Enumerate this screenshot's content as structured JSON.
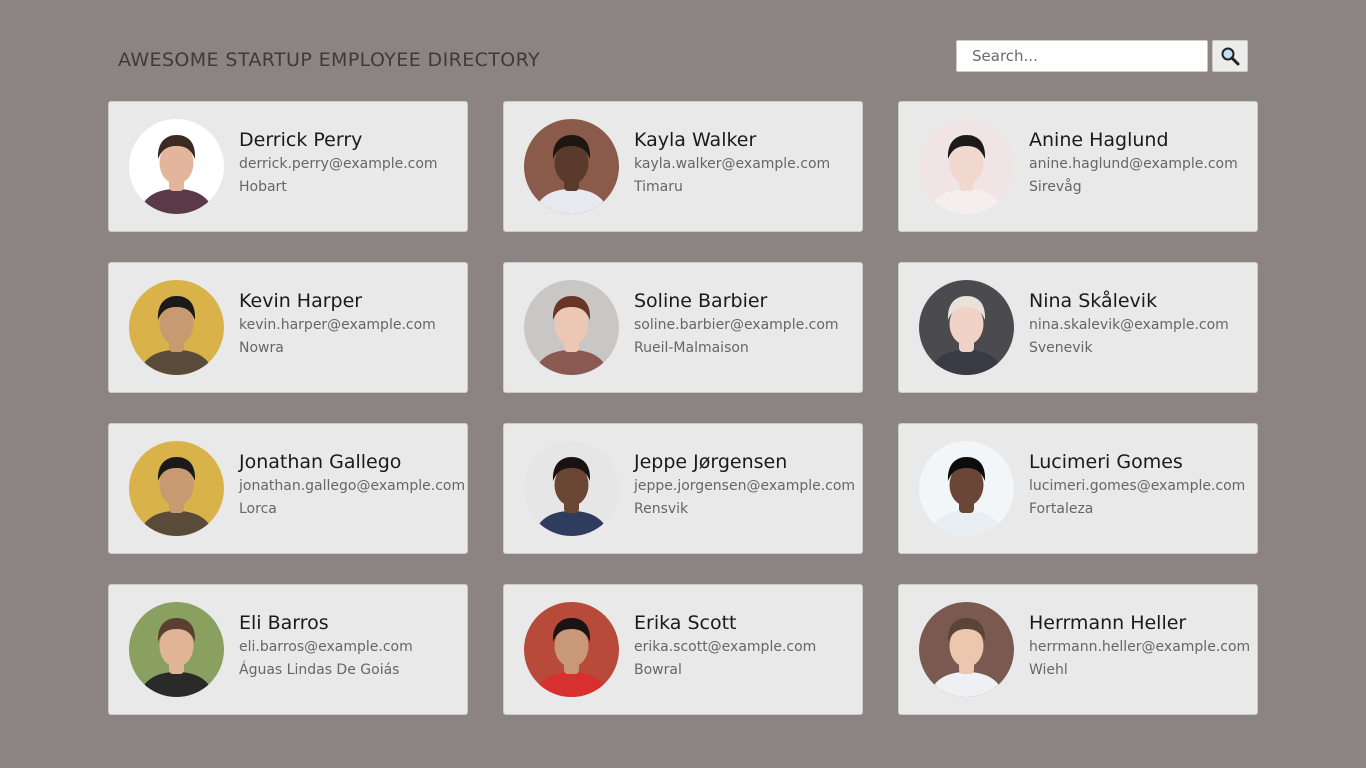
{
  "header": {
    "title": "AWESOME STARTUP EMPLOYEE DIRECTORY",
    "search_placeholder": "Search...",
    "search_icon": "magnifier-icon"
  },
  "employees": [
    {
      "name": "Derrick Perry",
      "email": "derrick.perry@example.com",
      "city": "Hobart",
      "avatar": {
        "bg": "#ffffff",
        "skin": "#e3b59c",
        "hair": "#3a2a22",
        "shirt": "#5b3a48"
      }
    },
    {
      "name": "Kayla Walker",
      "email": "kayla.walker@example.com",
      "city": "Timaru",
      "avatar": {
        "bg": "#8a5a4a",
        "skin": "#5a3a2c",
        "hair": "#1f1612",
        "shirt": "#e8e8f0"
      }
    },
    {
      "name": "Anine Haglund",
      "email": "anine.haglund@example.com",
      "city": "Sirevåg",
      "avatar": {
        "bg": "#f1e4e4",
        "skin": "#f0d8cf",
        "hair": "#1b1b1b",
        "shirt": "#f5eeee"
      }
    },
    {
      "name": "Kevin Harper",
      "email": "kevin.harper@example.com",
      "city": "Nowra",
      "avatar": {
        "bg": "#d9b24a",
        "skin": "#c89a72",
        "hair": "#1a1a1a",
        "shirt": "#5a4a3a"
      }
    },
    {
      "name": "Soline Barbier",
      "email": "soline.barbier@example.com",
      "city": "Rueil-Malmaison",
      "avatar": {
        "bg": "#c9c6c6",
        "skin": "#ecc8b4",
        "hair": "#6a3526",
        "shirt": "#8a5a52"
      }
    },
    {
      "name": "Nina Skålevik",
      "email": "nina.skalevik@example.com",
      "city": "Svenevik",
      "avatar": {
        "bg": "#4b4a4e",
        "skin": "#f0d2c6",
        "hair": "#e8e2d8",
        "shirt": "#3a3a44"
      }
    },
    {
      "name": "Jonathan Gallego",
      "email": "jonathan.gallego@example.com",
      "city": "Lorca",
      "avatar": {
        "bg": "#d9b24a",
        "skin": "#c89a72",
        "hair": "#1a1a1a",
        "shirt": "#5a4a3a"
      }
    },
    {
      "name": "Jeppe Jørgensen",
      "email": "jeppe.jorgensen@example.com",
      "city": "Rensvik",
      "avatar": {
        "bg": "#e6e6e6",
        "skin": "#6b4632",
        "hair": "#1a1210",
        "shirt": "#2e3c5e"
      }
    },
    {
      "name": "Lucimeri Gomes",
      "email": "lucimeri.gomes@example.com",
      "city": "Fortaleza",
      "avatar": {
        "bg": "#f3f6f8",
        "skin": "#6a4636",
        "hair": "#0c0c0c",
        "shirt": "#e8eef2"
      }
    },
    {
      "name": "Eli Barros",
      "email": "eli.barros@example.com",
      "city": "Águas Lindas De Goiás",
      "avatar": {
        "bg": "#8aa060",
        "skin": "#e2b497",
        "hair": "#5a4030",
        "shirt": "#2a2a2a"
      }
    },
    {
      "name": "Erika Scott",
      "email": "erika.scott@example.com",
      "city": "Bowral",
      "avatar": {
        "bg": "#b84a3a",
        "skin": "#c99878",
        "hair": "#1a1414",
        "shirt": "#d83030"
      }
    },
    {
      "name": "Herrmann Heller",
      "email": "herrmann.heller@example.com",
      "city": "Wiehl",
      "avatar": {
        "bg": "#7a5a50",
        "skin": "#ecc7ad",
        "hair": "#5a4436",
        "shirt": "#eef0f4"
      }
    }
  ]
}
